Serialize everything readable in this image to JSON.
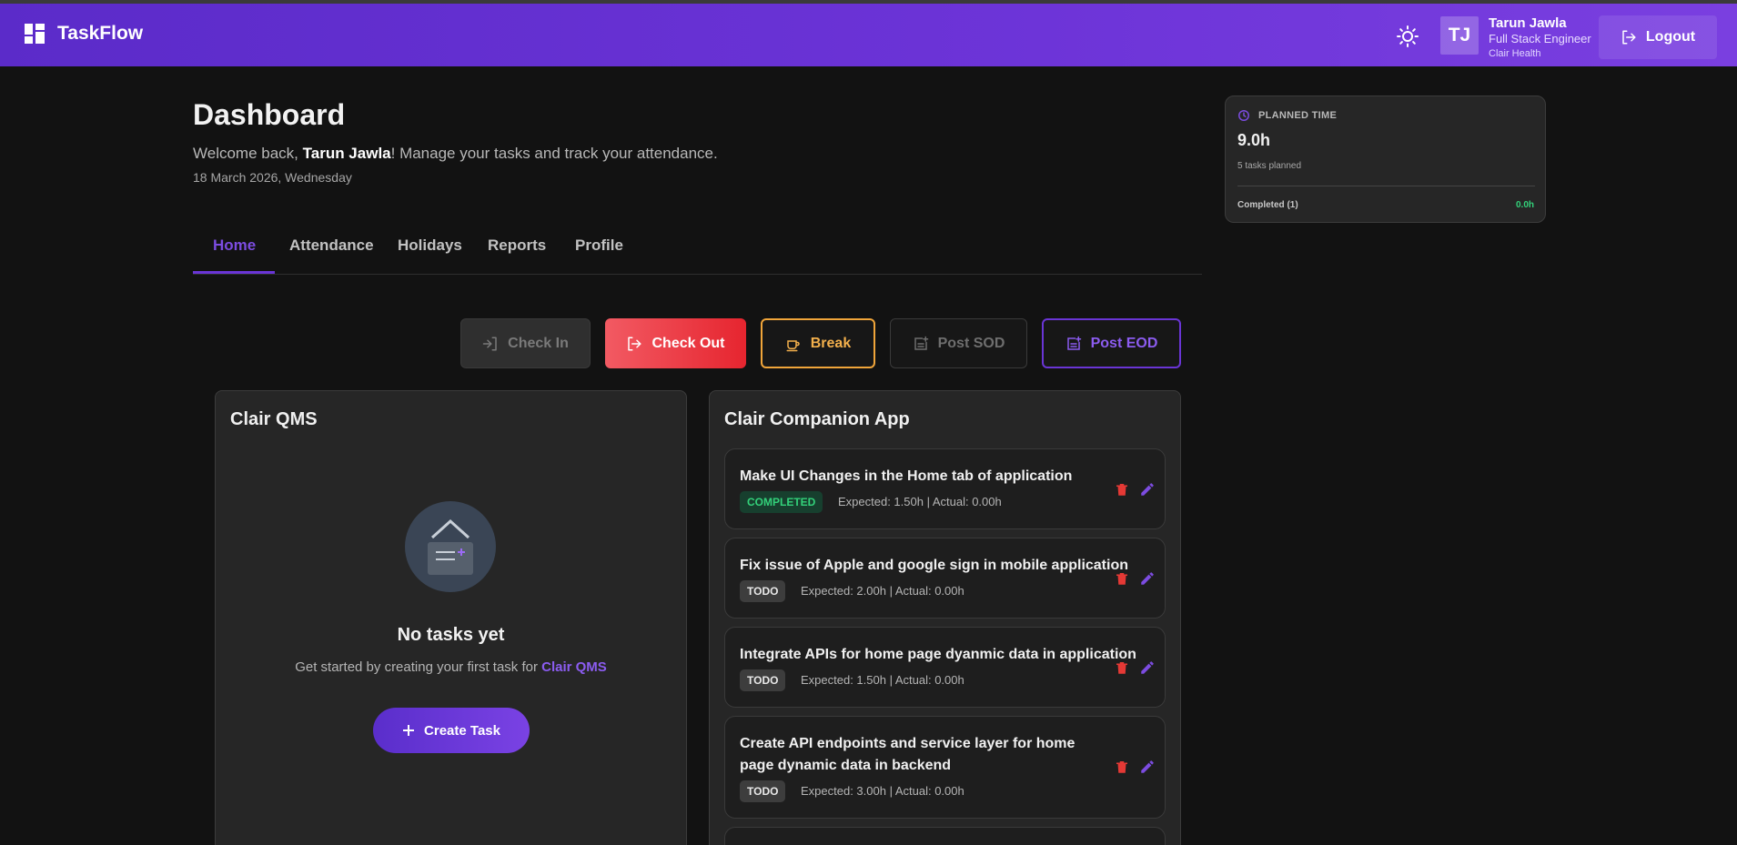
{
  "app": {
    "name": "TaskFlow"
  },
  "user": {
    "initials": "TJ",
    "name": "Tarun Jawla",
    "role": "Full Stack Engineer",
    "org": "Clair Health"
  },
  "header": {
    "logout_label": "Logout"
  },
  "page": {
    "title": "Dashboard",
    "welcome_prefix": "Welcome back, ",
    "welcome_name": "Tarun Jawla",
    "welcome_suffix": "! Manage your tasks and track your attendance.",
    "date": "18 March 2026, Wednesday"
  },
  "tabs": [
    "Home",
    "Attendance",
    "Holidays",
    "Reports",
    "Profile"
  ],
  "active_tab": "Home",
  "actions": {
    "check_in": "Check In",
    "check_out": "Check Out",
    "break": "Break",
    "post_sod": "Post SOD",
    "post_eod": "Post EOD"
  },
  "projects": {
    "qms": {
      "title": "Clair QMS",
      "empty_title": "No tasks yet",
      "empty_sub_prefix": "Get started by creating your first task for ",
      "empty_sub_project": "Clair QMS",
      "create_label": "Create Task"
    },
    "app": {
      "title": "Clair Companion App",
      "tasks": [
        {
          "title": "Make UI Changes in the Home tab of application",
          "status": "COMPLETED",
          "meta": "Expected: 1.50h | Actual: 0.00h"
        },
        {
          "title": "Fix issue of Apple and google sign in mobile application",
          "status": "TODO",
          "meta": "Expected: 2.00h | Actual: 0.00h"
        },
        {
          "title": "Integrate APIs for home page dyanmic data in application",
          "status": "TODO",
          "meta": "Expected: 1.50h | Actual: 0.00h"
        },
        {
          "title": "Create API endpoints and service layer for home page dynamic data in backend",
          "status": "TODO",
          "meta": "Expected: 3.00h | Actual: 0.00h"
        }
      ]
    }
  },
  "planned": {
    "label": "PLANNED TIME",
    "value": "9.0h",
    "sub": "5 tasks planned",
    "completed_label": "Completed (1)",
    "completed_value": "0.0h"
  },
  "colors": {
    "accent": "#6a35d6",
    "danger": "#e6252f",
    "warning": "#f0a53a",
    "success": "#33d17a"
  }
}
